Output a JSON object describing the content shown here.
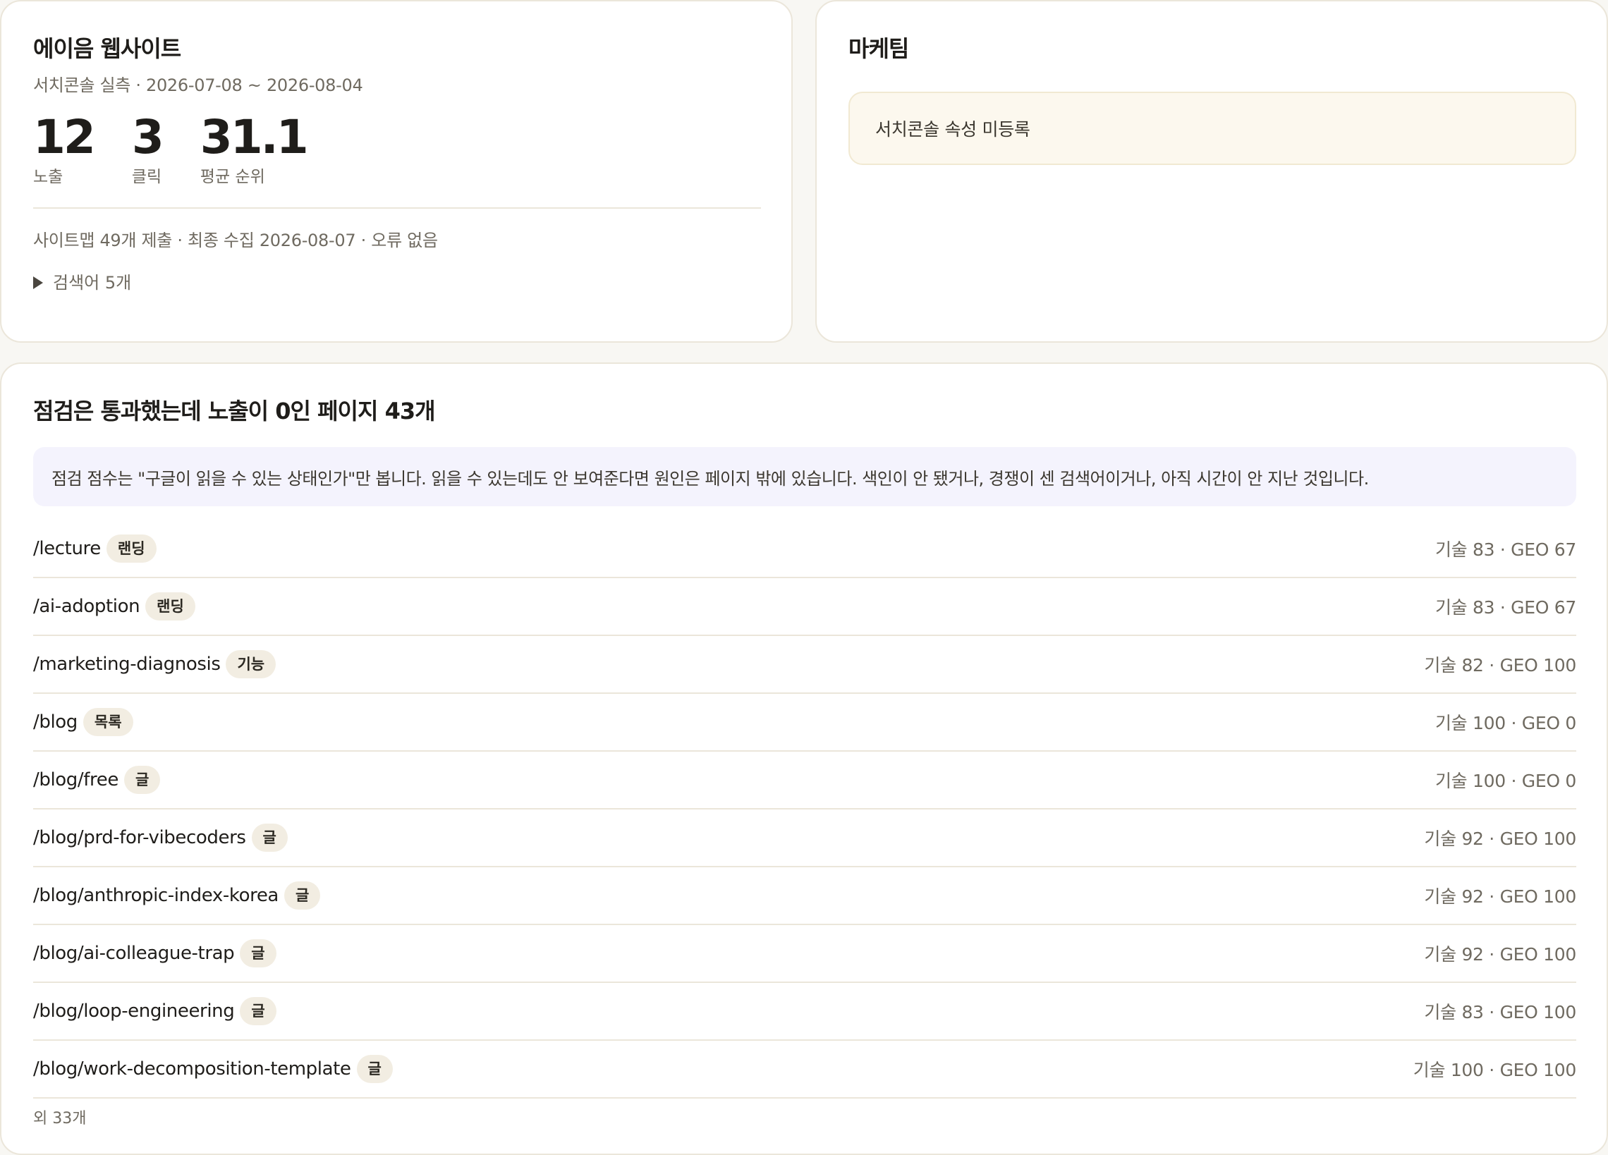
{
  "site_card": {
    "title": "에이음 웹사이트",
    "subtitle": "서치콘솔 실측 · 2026-07-08 ~ 2026-08-04",
    "stats": [
      {
        "value": "12",
        "label": "노출"
      },
      {
        "value": "3",
        "label": "클릭"
      },
      {
        "value": "31.1",
        "label": "평균 순위"
      }
    ],
    "sitemap_line": "사이트맵 49개 제출 · 최종 수집 2026-08-07 · 오류 없음",
    "keywords_toggle": "검색어 5개"
  },
  "team_card": {
    "title": "마케팀",
    "notice": "서치콘솔 속성 미등록"
  },
  "pages_card": {
    "title": "점검은 통과했는데 노출이 0인 페이지 43개",
    "info": "점검 점수는 \"구글이 읽을 수 있는 상태인가\"만 봅니다. 읽을 수 있는데도 안 보여준다면 원인은 페이지 밖에 있습니다. 색인이 안 됐거나, 경쟁이 센 검색어이거나, 아직 시간이 안 지난 것입니다.",
    "rows": [
      {
        "path": "/lecture",
        "tag": "랜딩",
        "score": "기술 83 · GEO 67"
      },
      {
        "path": "/ai-adoption",
        "tag": "랜딩",
        "score": "기술 83 · GEO 67"
      },
      {
        "path": "/marketing-diagnosis",
        "tag": "기능",
        "score": "기술 82 · GEO 100"
      },
      {
        "path": "/blog",
        "tag": "목록",
        "score": "기술 100 · GEO 0"
      },
      {
        "path": "/blog/free",
        "tag": "글",
        "score": "기술 100 · GEO 0"
      },
      {
        "path": "/blog/prd-for-vibecoders",
        "tag": "글",
        "score": "기술 92 · GEO 100"
      },
      {
        "path": "/blog/anthropic-index-korea",
        "tag": "글",
        "score": "기술 92 · GEO 100"
      },
      {
        "path": "/blog/ai-colleague-trap",
        "tag": "글",
        "score": "기술 92 · GEO 100"
      },
      {
        "path": "/blog/loop-engineering",
        "tag": "글",
        "score": "기술 83 · GEO 100"
      },
      {
        "path": "/blog/work-decomposition-template",
        "tag": "글",
        "score": "기술 100 · GEO 100"
      }
    ],
    "more": "외 33개"
  }
}
